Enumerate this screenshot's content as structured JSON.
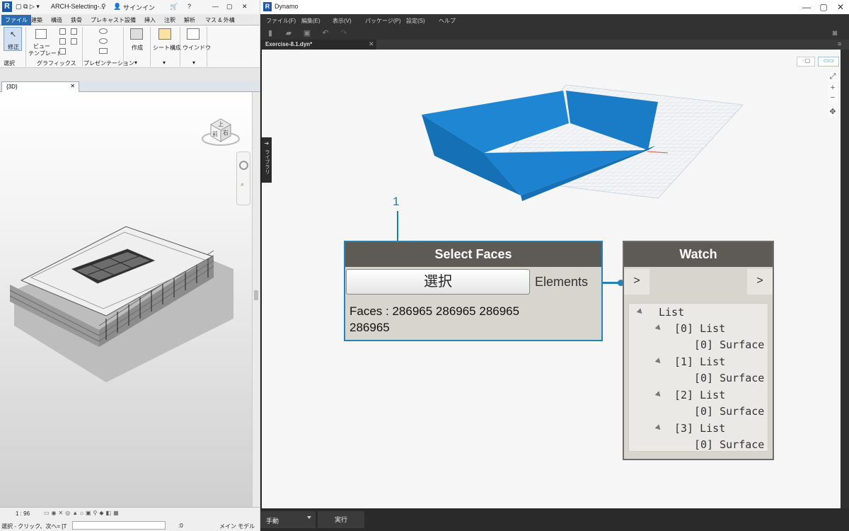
{
  "revit": {
    "app_title": "ARCH-Selecting-...",
    "signin": "サインイン",
    "tabs": [
      "ファイル",
      "建築",
      "構造",
      "鉄骨",
      "プレキャスト",
      "設備",
      "挿入",
      "注釈",
      "解析",
      "マス & 外構"
    ],
    "ribbon": {
      "modify": "修正",
      "select": "選択",
      "view_template": "ビュー",
      "view_template2": "テンプレート",
      "graphics": "グラフィックス",
      "presentation": "プレゼンテーション",
      "create": "作成",
      "sheet": "シート構成",
      "window": "ウインドウ"
    },
    "view_tab": "{3D}",
    "viewcube": {
      "top": "上",
      "front": "前",
      "right": "右"
    },
    "scale": "1 : 96",
    "status_text": "選択 - クリック、次へ= [T",
    "status_count": ":0",
    "status_model": "メイン モデル"
  },
  "dynamo": {
    "title": "Dynamo",
    "menu": [
      "ファイル(F)",
      "編集(E)",
      "表示(V)",
      "パッケージ(P)",
      "設定(S)",
      "ヘルプ"
    ],
    "tab_name": "Exercise-8.1.dyn*",
    "library_label": "ライブラリ",
    "callout": "1",
    "select_node": {
      "title": "Select Faces",
      "button": "選択",
      "port": "Elements",
      "output_line1": "Faces : 286965 286965 286965",
      "output_line2": "286965"
    },
    "watch_node": {
      "title": "Watch",
      "in_port": ">",
      "out_port": ">",
      "root": "List",
      "items": [
        {
          "index": "[0] List",
          "child": "[0] Surface"
        },
        {
          "index": "[1] List",
          "child": "[0] Surface"
        },
        {
          "index": "[2] List",
          "child": "[0] Surface"
        },
        {
          "index": "[3] List",
          "child": "[0] Surface"
        }
      ]
    },
    "run_mode": "手動",
    "run_button": "実行",
    "colors": {
      "accent": "#2384bc",
      "surface_blue": "#1e86d4",
      "node_header": "#5e5a55"
    }
  }
}
